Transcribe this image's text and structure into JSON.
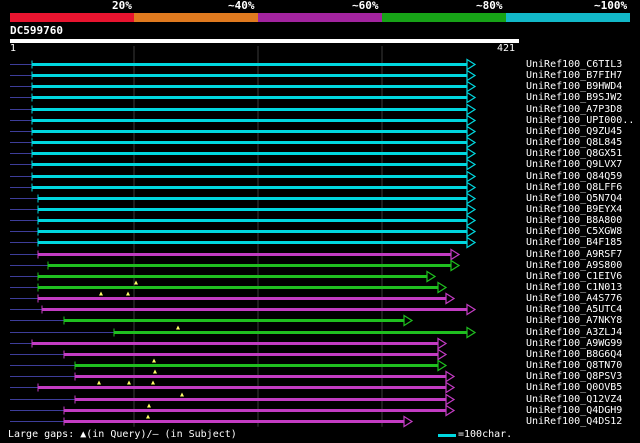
{
  "colors": {
    "seg20": "#e8142f",
    "seg40": "#e07a1f",
    "seg60": "#a3249f",
    "seg80": "#17a317",
    "seg100": "#12b8c8",
    "cyan": "#00d8e0",
    "green": "#1fbf1f",
    "magenta": "#c33cc3",
    "gap": "#ffff66",
    "grid": "#3a3a3a",
    "leftline": "#3d3d9a"
  },
  "scale": {
    "labels": [
      "20%",
      "~40%",
      "~60%",
      "~80%",
      "~100%"
    ]
  },
  "query": {
    "name": "DC599760",
    "start": "1",
    "end": "421"
  },
  "hits": [
    {
      "id": "UniRef100_C6TIL3",
      "color": "cyan",
      "start": 32,
      "end": 473
    },
    {
      "id": "UniRef100_B7FIH7",
      "color": "cyan",
      "start": 32,
      "end": 473
    },
    {
      "id": "UniRef100_B9HWD4",
      "color": "cyan",
      "start": 32,
      "end": 473
    },
    {
      "id": "UniRef100_B9SJW2",
      "color": "cyan",
      "start": 32,
      "end": 473
    },
    {
      "id": "UniRef100_A7P3D8",
      "color": "cyan",
      "start": 32,
      "end": 473
    },
    {
      "id": "UniRef100_UPI000..",
      "color": "cyan",
      "start": 32,
      "end": 473
    },
    {
      "id": "UniRef100_Q9ZU45",
      "color": "cyan",
      "start": 32,
      "end": 473
    },
    {
      "id": "UniRef100_Q8L845",
      "color": "cyan",
      "start": 32,
      "end": 473
    },
    {
      "id": "UniRef100_Q8GX51",
      "color": "cyan",
      "start": 32,
      "end": 473
    },
    {
      "id": "UniRef100_Q9LVX7",
      "color": "cyan",
      "start": 32,
      "end": 473
    },
    {
      "id": "UniRef100_Q84Q59",
      "color": "cyan",
      "start": 32,
      "end": 473
    },
    {
      "id": "UniRef100_Q8LFF6",
      "color": "cyan",
      "start": 32,
      "end": 473
    },
    {
      "id": "UniRef100_Q5N7Q4",
      "color": "cyan",
      "start": 38,
      "end": 473
    },
    {
      "id": "UniRef100_B9EYX4",
      "color": "cyan",
      "start": 38,
      "end": 473
    },
    {
      "id": "UniRef100_B8A800",
      "color": "cyan",
      "start": 38,
      "end": 473
    },
    {
      "id": "UniRef100_C5XGW8",
      "color": "cyan",
      "start": 38,
      "end": 473
    },
    {
      "id": "UniRef100_B4F185",
      "color": "cyan",
      "start": 38,
      "end": 473
    },
    {
      "id": "UniRef100_A9RSF7",
      "color": "magenta",
      "start": 38,
      "end": 457
    },
    {
      "id": "UniRef100_A9S800",
      "color": "green",
      "start": 48,
      "end": 457
    },
    {
      "id": "UniRef100_C1EIV6",
      "color": "green",
      "start": 38,
      "end": 433
    },
    {
      "id": "UniRef100_C1N013",
      "color": "green",
      "start": 38,
      "end": 444,
      "gaps": [
        136
      ]
    },
    {
      "id": "UniRef100_A4S776",
      "color": "magenta",
      "start": 38,
      "end": 452,
      "gaps": [
        101,
        128
      ]
    },
    {
      "id": "UniRef100_A5UTC4",
      "color": "magenta",
      "start": 42,
      "end": 473
    },
    {
      "id": "UniRef100_A7NKY8",
      "color": "green",
      "start": 64,
      "end": 410
    },
    {
      "id": "UniRef100_A3ZLJ4",
      "color": "green",
      "start": 114,
      "end": 473,
      "gaps": [
        178
      ]
    },
    {
      "id": "UniRef100_A9WG99",
      "color": "magenta",
      "start": 32,
      "end": 444
    },
    {
      "id": "UniRef100_B8G6Q4",
      "color": "magenta",
      "start": 64,
      "end": 444
    },
    {
      "id": "UniRef100_Q8TN70",
      "color": "green",
      "start": 75,
      "end": 444,
      "gaps": [
        154
      ]
    },
    {
      "id": "UniRef100_Q8PSV3",
      "color": "magenta",
      "start": 75,
      "end": 452,
      "gaps": [
        155
      ]
    },
    {
      "id": "UniRef100_Q0OVB5",
      "color": "magenta",
      "start": 38,
      "end": 452,
      "gaps": [
        99,
        129,
        153
      ]
    },
    {
      "id": "UniRef100_Q12VZ4",
      "color": "magenta",
      "start": 75,
      "end": 452,
      "gaps": [
        182
      ]
    },
    {
      "id": "UniRef100_Q4DGH9",
      "color": "magenta",
      "start": 64,
      "end": 452,
      "gaps": [
        149
      ]
    },
    {
      "id": "UniRef100_Q4DS12",
      "color": "magenta",
      "start": 64,
      "end": 410,
      "gaps": [
        148
      ]
    }
  ],
  "footer": {
    "gaps_text": "Large gaps: ▲(in Query)/– (in Subject)",
    "legend_text": "=100char."
  }
}
